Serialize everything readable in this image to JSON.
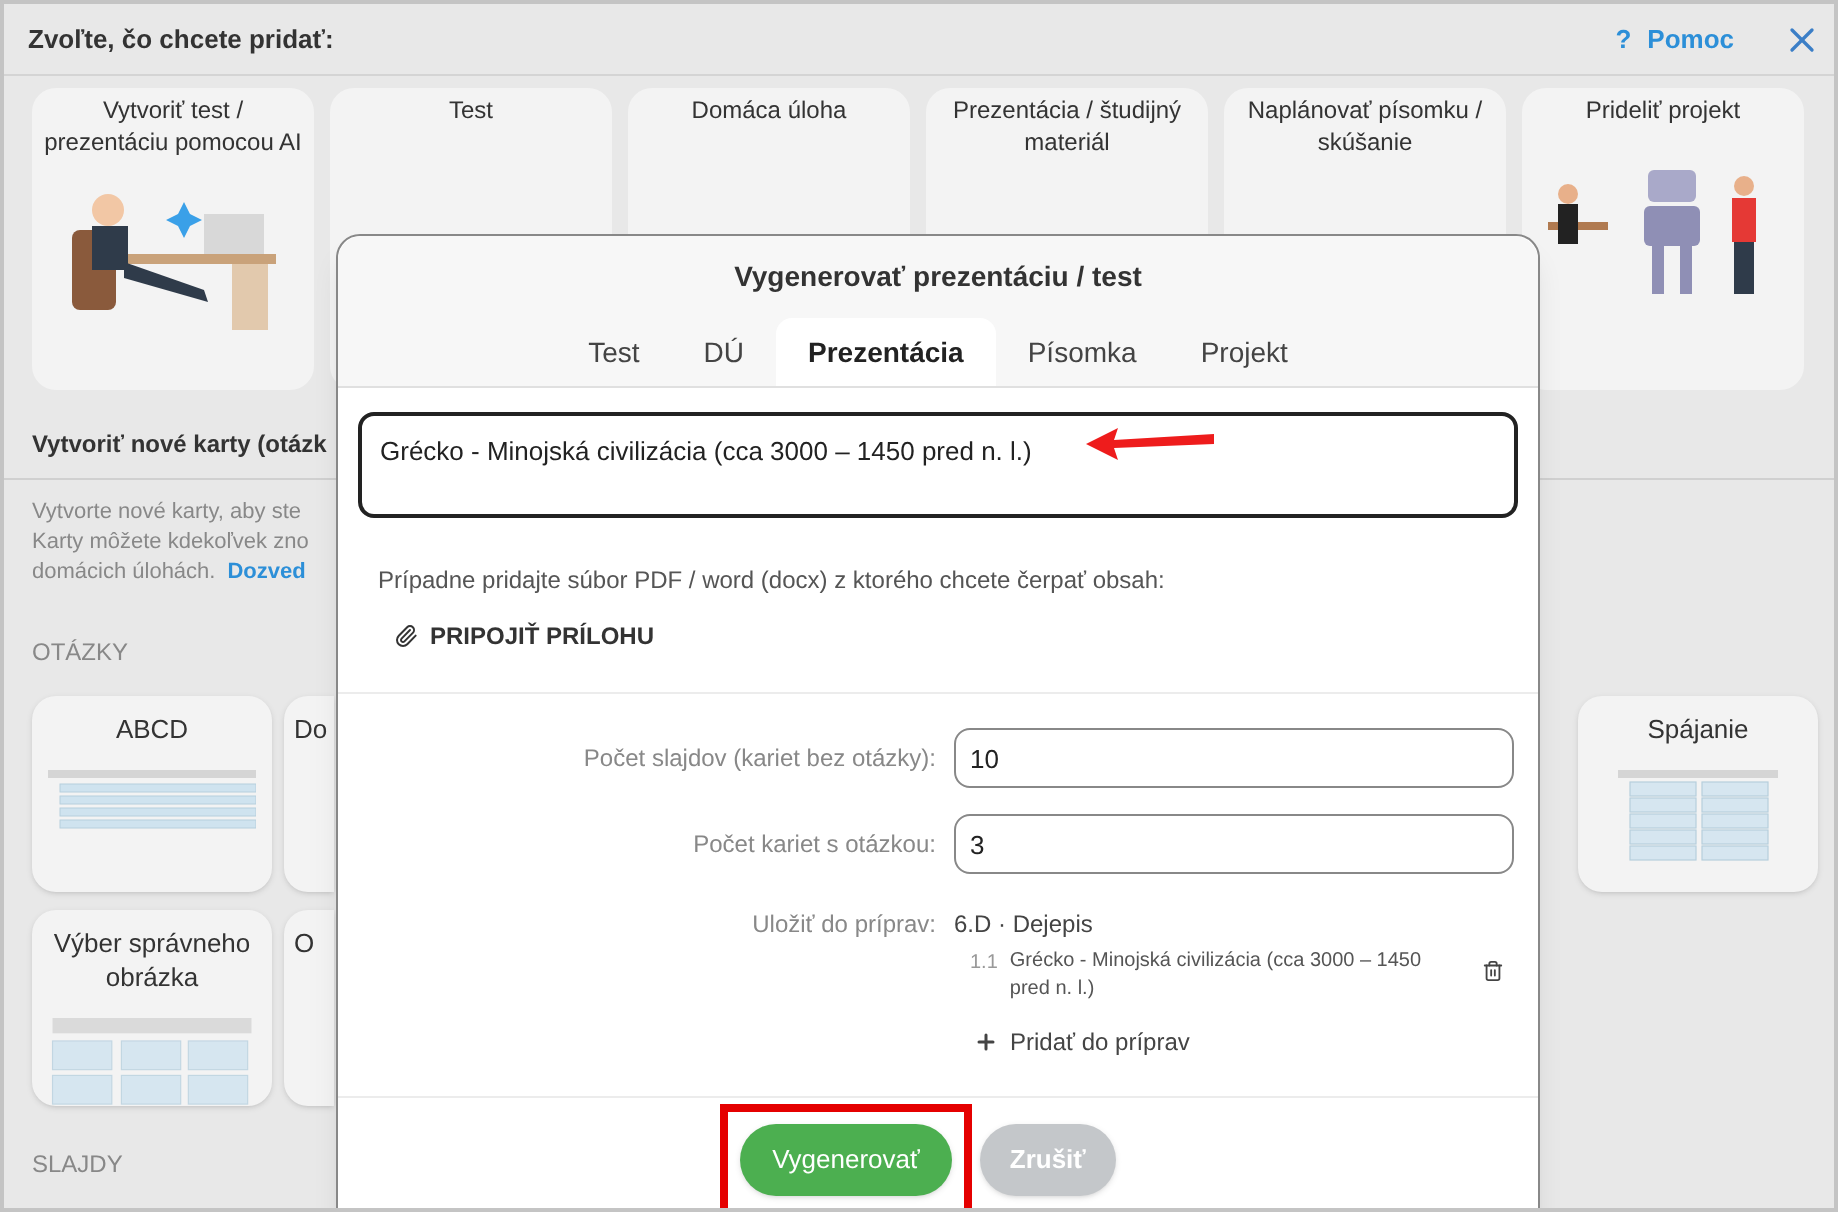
{
  "header": {
    "title": "Zvoľte, čo chcete pridať:",
    "help_mark": "?",
    "help": "Pomoc"
  },
  "top_cards": [
    {
      "label": "Vytvoriť test / prezentáciu pomocou AI",
      "kind": "ai"
    },
    {
      "label": "Test",
      "kind": "plain"
    },
    {
      "label": "Domáca úloha",
      "kind": "plain"
    },
    {
      "label": "Prezentácia / študijný materiál",
      "kind": "plain"
    },
    {
      "label": "Naplánovať písomku / skúšanie",
      "kind": "plain"
    },
    {
      "label": "Prideliť projekt",
      "kind": "robot"
    }
  ],
  "section": {
    "title": "Vytvoriť nové karty (otázk",
    "lines": [
      "Vytvorte nové karty, aby ste",
      "Karty môžete kdekoľvek zno",
      "domácich úlohách."
    ],
    "link": "Dozved"
  },
  "questions": {
    "heading": "OTÁZKY",
    "cards": [
      {
        "label": "ABCD",
        "kind": "abcd"
      },
      {
        "label": "Do",
        "kind": "partial"
      },
      {
        "label": "Spájanie",
        "kind": "matching"
      },
      {
        "label": "Výber správneho obrázka",
        "kind": "grid"
      },
      {
        "label": "O",
        "kind": "partial"
      }
    ]
  },
  "slides": {
    "heading": "SLAJDY"
  },
  "dialog": {
    "title": "Vygenerovať prezentáciu / test",
    "tabs": [
      {
        "label": "Test",
        "selected": false
      },
      {
        "label": "DÚ",
        "selected": false
      },
      {
        "label": "Prezentácia",
        "selected": true
      },
      {
        "label": "Písomka",
        "selected": false
      },
      {
        "label": "Projekt",
        "selected": false
      }
    ],
    "topic": "Grécko - Minojská civilizácia (cca 3000 – 1450 pred n. l.)",
    "attach_hint": "Prípadne pridajte súbor PDF / word (docx) z ktorého chcete čerpať obsah:",
    "attach_button": "PRIPOJIŤ PRÍLOHU",
    "fields": [
      {
        "label": "Počet slajdov (kariet bez otázky):",
        "value": "10"
      },
      {
        "label": "Počet kariet s otázkou:",
        "value": "3"
      }
    ],
    "save": {
      "label": "Uložiť do príprav:",
      "course": "6.D · Dejepis",
      "items": [
        {
          "number": "1.1",
          "title": "Grécko - Minojská civilizácia (cca 3000 – 1450 pred n. l.)"
        }
      ],
      "add": "Pridať do príprav"
    },
    "buttons": [
      {
        "label": "Vygenerovať",
        "kind": "primary",
        "highlighted": true
      },
      {
        "label": "Zrušiť",
        "kind": "secondary",
        "highlighted": false
      }
    ]
  }
}
